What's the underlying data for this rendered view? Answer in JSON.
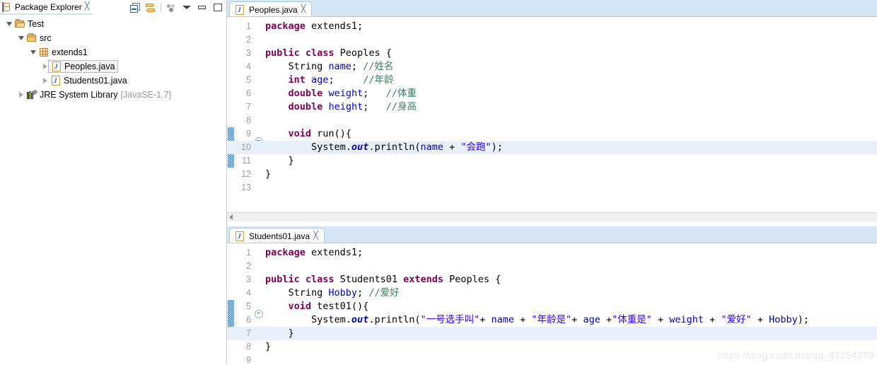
{
  "explorer": {
    "tab": {
      "label": "Package Explorer",
      "icon": "package-explorer-icon",
      "close": "╳"
    },
    "toolbar": [
      {
        "name": "collapse-all-button",
        "title": "Collapse All"
      },
      {
        "name": "link-with-editor-button",
        "title": "Link with Editor"
      },
      {
        "name": "focus-on-active-task-button",
        "title": "Focus on Active Task"
      },
      {
        "name": "view-menu-button",
        "title": "View Menu"
      },
      {
        "name": "minimize-button",
        "title": "Minimize"
      },
      {
        "name": "maximize-button",
        "title": "Maximize"
      }
    ],
    "tree": [
      {
        "label": "Test",
        "icon": "project-icon",
        "indent": 0,
        "arrow": "expanded",
        "selected": false,
        "suffix": ""
      },
      {
        "label": "src",
        "icon": "source-folder-icon",
        "indent": 1,
        "arrow": "expanded",
        "selected": false,
        "suffix": ""
      },
      {
        "label": "extends1",
        "icon": "package-icon",
        "indent": 2,
        "arrow": "expanded",
        "selected": false,
        "suffix": ""
      },
      {
        "label": "Peoples.java",
        "icon": "java-file-icon",
        "indent": 3,
        "arrow": "collapsed",
        "selected": true,
        "suffix": ""
      },
      {
        "label": "Students01.java",
        "icon": "java-file-icon",
        "indent": 3,
        "arrow": "collapsed",
        "selected": false,
        "suffix": ""
      },
      {
        "label": "JRE System Library",
        "icon": "jre-library-icon",
        "indent": 1,
        "arrow": "collapsed",
        "selected": false,
        "suffix": "[JavaSE-1.7]"
      }
    ]
  },
  "editors": [
    {
      "tab": {
        "label": "Peoples.java",
        "icon": "java-file-icon",
        "close": "╳",
        "active": true
      },
      "change_bar": {
        "from_line": 9,
        "to_line": 11
      },
      "highlight_line": 10,
      "has_hscrollbar": true,
      "lines": [
        {
          "n": "1",
          "fold": false,
          "tokens": [
            {
              "t": "package",
              "c": "kw"
            },
            {
              "t": " extends1;",
              "c": "pln"
            }
          ]
        },
        {
          "n": "2",
          "fold": false,
          "tokens": []
        },
        {
          "n": "3",
          "fold": false,
          "tokens": [
            {
              "t": "public class",
              "c": "kw"
            },
            {
              "t": " Peoples {",
              "c": "pln"
            }
          ]
        },
        {
          "n": "4",
          "fold": false,
          "tokens": [
            {
              "t": "    String ",
              "c": "pln"
            },
            {
              "t": "name",
              "c": "fld"
            },
            {
              "t": "; ",
              "c": "pln"
            },
            {
              "t": "//姓名",
              "c": "cmt"
            }
          ]
        },
        {
          "n": "5",
          "fold": false,
          "tokens": [
            {
              "t": "    ",
              "c": "pln"
            },
            {
              "t": "int",
              "c": "kw"
            },
            {
              "t": " ",
              "c": "pln"
            },
            {
              "t": "age",
              "c": "fld"
            },
            {
              "t": ";     ",
              "c": "pln"
            },
            {
              "t": "//年龄",
              "c": "cmt"
            }
          ]
        },
        {
          "n": "6",
          "fold": false,
          "tokens": [
            {
              "t": "    ",
              "c": "pln"
            },
            {
              "t": "double",
              "c": "kw"
            },
            {
              "t": " ",
              "c": "pln"
            },
            {
              "t": "weight",
              "c": "fld"
            },
            {
              "t": ";   ",
              "c": "pln"
            },
            {
              "t": "//体重",
              "c": "cmt"
            }
          ]
        },
        {
          "n": "7",
          "fold": false,
          "tokens": [
            {
              "t": "    ",
              "c": "pln"
            },
            {
              "t": "double",
              "c": "kw"
            },
            {
              "t": " ",
              "c": "pln"
            },
            {
              "t": "height",
              "c": "fld"
            },
            {
              "t": ";   ",
              "c": "pln"
            },
            {
              "t": "//身高",
              "c": "cmt"
            }
          ]
        },
        {
          "n": "8",
          "fold": false,
          "tokens": []
        },
        {
          "n": "9",
          "fold": true,
          "tokens": [
            {
              "t": "    ",
              "c": "pln"
            },
            {
              "t": "void",
              "c": "kw"
            },
            {
              "t": " run(){",
              "c": "pln"
            }
          ]
        },
        {
          "n": "10",
          "fold": false,
          "tokens": [
            {
              "t": "        System.",
              "c": "pln"
            },
            {
              "t": "out",
              "c": "sfld"
            },
            {
              "t": ".println(",
              "c": "pln"
            },
            {
              "t": "name",
              "c": "fld"
            },
            {
              "t": " + ",
              "c": "pln"
            },
            {
              "t": "\"会跑\"",
              "c": "str"
            },
            {
              "t": ");",
              "c": "pln"
            }
          ]
        },
        {
          "n": "11",
          "fold": false,
          "tokens": [
            {
              "t": "    }",
              "c": "pln"
            }
          ]
        },
        {
          "n": "12",
          "fold": false,
          "tokens": [
            {
              "t": "}",
              "c": "pln"
            }
          ]
        },
        {
          "n": "13",
          "fold": false,
          "tokens": []
        }
      ]
    },
    {
      "tab": {
        "label": "Students01.java",
        "icon": "java-file-icon",
        "close": "╳",
        "active": true
      },
      "change_bar": {
        "from_line": 5,
        "to_line": 7
      },
      "highlight_line": 7,
      "has_hscrollbar": false,
      "lines": [
        {
          "n": "1",
          "fold": false,
          "tokens": [
            {
              "t": "package",
              "c": "kw"
            },
            {
              "t": " extends1;",
              "c": "pln"
            }
          ]
        },
        {
          "n": "2",
          "fold": false,
          "tokens": []
        },
        {
          "n": "3",
          "fold": false,
          "tokens": [
            {
              "t": "public class",
              "c": "kw"
            },
            {
              "t": " Students01 ",
              "c": "pln"
            },
            {
              "t": "extends",
              "c": "kw"
            },
            {
              "t": " Peoples {",
              "c": "pln"
            }
          ]
        },
        {
          "n": "4",
          "fold": false,
          "tokens": [
            {
              "t": "    String ",
              "c": "pln"
            },
            {
              "t": "Hobby",
              "c": "fld"
            },
            {
              "t": "; ",
              "c": "pln"
            },
            {
              "t": "//爱好",
              "c": "cmt"
            }
          ]
        },
        {
          "n": "5",
          "fold": true,
          "tokens": [
            {
              "t": "    ",
              "c": "pln"
            },
            {
              "t": "void",
              "c": "kw"
            },
            {
              "t": " test01(){",
              "c": "pln"
            }
          ]
        },
        {
          "n": "6",
          "fold": false,
          "tokens": [
            {
              "t": "        System.",
              "c": "pln"
            },
            {
              "t": "out",
              "c": "sfld"
            },
            {
              "t": ".println(",
              "c": "pln"
            },
            {
              "t": "\"一号选手叫\"",
              "c": "str"
            },
            {
              "t": "+ ",
              "c": "pln"
            },
            {
              "t": "name",
              "c": "fld"
            },
            {
              "t": " + ",
              "c": "pln"
            },
            {
              "t": "\"年龄是\"",
              "c": "str"
            },
            {
              "t": "+ ",
              "c": "pln"
            },
            {
              "t": "age",
              "c": "fld"
            },
            {
              "t": " +",
              "c": "pln"
            },
            {
              "t": "\"体重是\"",
              "c": "str"
            },
            {
              "t": " + ",
              "c": "pln"
            },
            {
              "t": "weight",
              "c": "fld"
            },
            {
              "t": " + ",
              "c": "pln"
            },
            {
              "t": "\"爱好\"",
              "c": "str"
            },
            {
              "t": " + ",
              "c": "pln"
            },
            {
              "t": "Hobby",
              "c": "fld"
            },
            {
              "t": ");",
              "c": "pln"
            }
          ]
        },
        {
          "n": "7",
          "fold": false,
          "tokens": [
            {
              "t": "    }",
              "c": "pln"
            }
          ]
        },
        {
          "n": "8",
          "fold": false,
          "tokens": [
            {
              "t": "}",
              "c": "pln"
            }
          ]
        },
        {
          "n": "9",
          "fold": false,
          "tokens": []
        }
      ]
    }
  ],
  "watermark": "https://blog.csdn.net/qq_41254299",
  "colors": {
    "keyword": "#7f0055",
    "string": "#2a00ff",
    "comment": "#3f7f5f",
    "field": "#0000c0",
    "line_number": "#a0a0a0",
    "current_line": "#e8f1fb",
    "change_bar": "#2f7fd0",
    "tab_bar": "#d6e6f5"
  }
}
